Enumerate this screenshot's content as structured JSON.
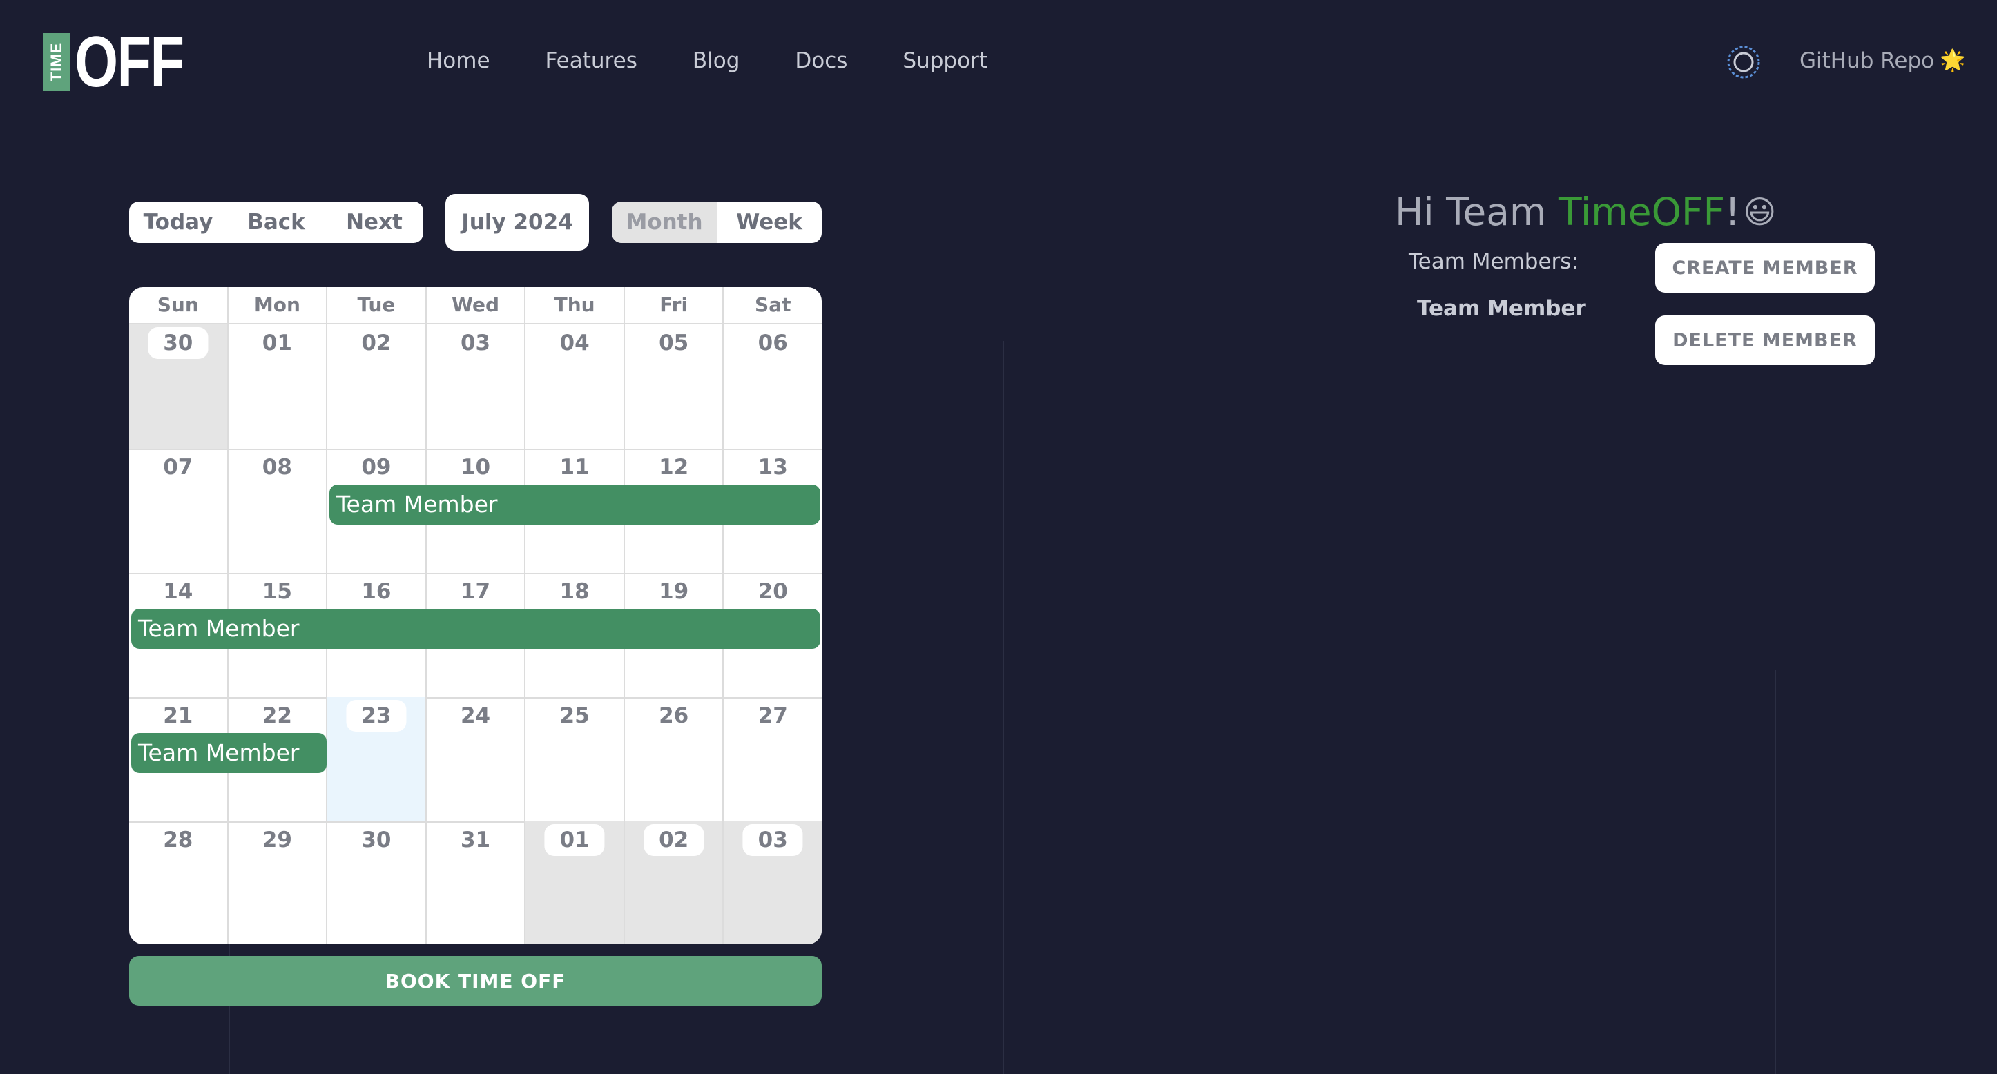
{
  "brand": {
    "logo_small": "TIME",
    "logo_big": "OFF"
  },
  "nav": [
    "Home",
    "Features",
    "Blog",
    "Docs",
    "Support"
  ],
  "header_right": {
    "github_label": "GitHub Repo",
    "star": "🌟"
  },
  "toolbar": {
    "today": "Today",
    "back": "Back",
    "next": "Next",
    "month_label": "July 2024",
    "views": {
      "month": "Month",
      "week": "Week",
      "active": "Month"
    }
  },
  "calendar": {
    "weekdays": [
      "Sun",
      "Mon",
      "Tue",
      "Wed",
      "Thu",
      "Fri",
      "Sat"
    ],
    "weeks": [
      [
        "30",
        "01",
        "02",
        "03",
        "04",
        "05",
        "06"
      ],
      [
        "07",
        "08",
        "09",
        "10",
        "11",
        "12",
        "13"
      ],
      [
        "14",
        "15",
        "16",
        "17",
        "18",
        "19",
        "20"
      ],
      [
        "21",
        "22",
        "23",
        "24",
        "25",
        "26",
        "27"
      ],
      [
        "28",
        "29",
        "30",
        "31",
        "01",
        "02",
        "03"
      ]
    ],
    "today": "23",
    "events": [
      {
        "label": "Team Member",
        "start": "Tue Jul 09",
        "end": "Sat Jul 13"
      },
      {
        "label": "Team Member",
        "start": "Sun Jul 14",
        "end": "Sat Jul 20"
      },
      {
        "label": "Team Member",
        "start": "Sun Jul 21",
        "end": "Mon Jul 22"
      }
    ]
  },
  "book_button": "BOOK TIME OFF",
  "panel": {
    "greeting_prefix": "Hi Team ",
    "greeting_brand": "TimeOFF",
    "greeting_suffix": "!",
    "emoji": "😃",
    "members_label": "Team Members:",
    "members": [
      "Team Member"
    ],
    "create_button": "CREATE MEMBER",
    "delete_button": "DELETE MEMBER"
  },
  "colors": {
    "background": "#1b1d31",
    "accent": "#5fa37c",
    "event": "#438f63",
    "brand_text": "#3a9a37"
  }
}
